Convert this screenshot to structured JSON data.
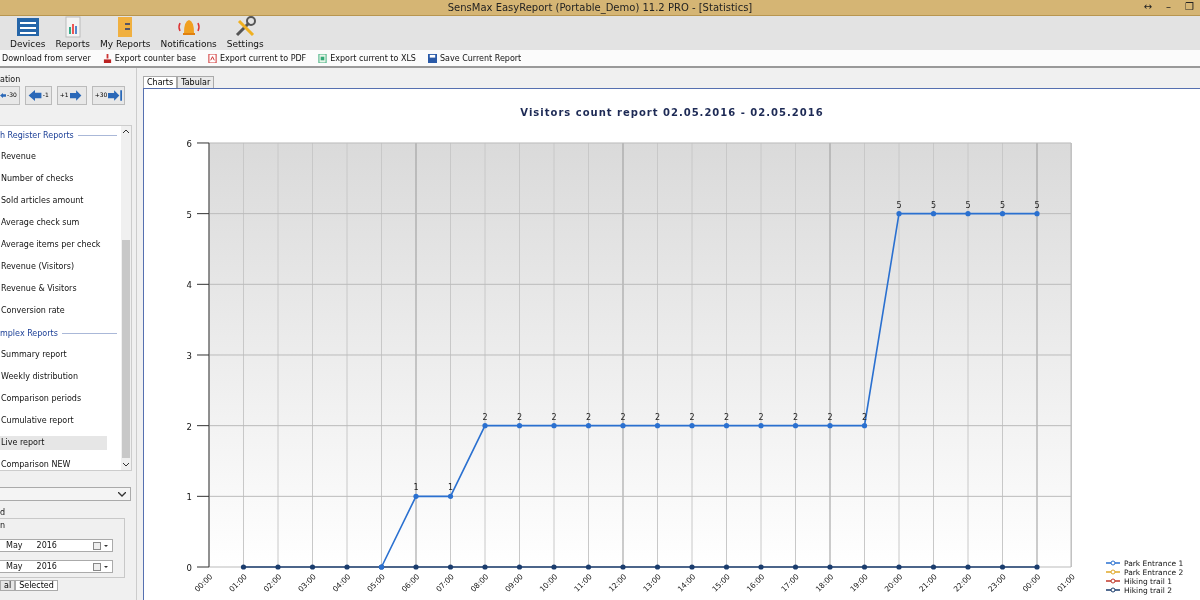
{
  "window": {
    "title": "SensMax EasyReport (Portable_Demo) 11.2 PRO - [Statistics]",
    "controls": [
      "↔",
      "–",
      "❐"
    ]
  },
  "toolbar": [
    {
      "label": "Devices",
      "kind": "devices"
    },
    {
      "label": "Reports",
      "kind": "reports"
    },
    {
      "label": "My Reports",
      "kind": "myreports"
    },
    {
      "label": "Notifications",
      "kind": "bell"
    },
    {
      "label": "Settings",
      "kind": "tools"
    }
  ],
  "commands": [
    {
      "label": "Download from server",
      "kind": "none"
    },
    {
      "label": "Export counter base",
      "kind": "export"
    },
    {
      "label": "Export current to PDF",
      "kind": "pdf"
    },
    {
      "label": "Export current to XLS",
      "kind": "xls"
    },
    {
      "label": "Save Current Report",
      "kind": "save"
    }
  ],
  "navigation": {
    "label": "ation",
    "buttons": [
      {
        "label": "-30",
        "kind": "first"
      },
      {
        "label": "-1",
        "kind": "prev"
      },
      {
        "label": "+1",
        "kind": "next"
      },
      {
        "label": "+30",
        "kind": "last"
      }
    ]
  },
  "report_list": [
    {
      "kind": "header",
      "label": "h Register Reports"
    },
    {
      "kind": "item",
      "label": "Revenue",
      "selected": false
    },
    {
      "kind": "item",
      "label": "Number of checks",
      "selected": false
    },
    {
      "kind": "item",
      "label": "Sold articles amount",
      "selected": false
    },
    {
      "kind": "item",
      "label": "Average check sum",
      "selected": false
    },
    {
      "kind": "item",
      "label": "Average items per check",
      "selected": false
    },
    {
      "kind": "item",
      "label": "Revenue (Visitors)",
      "selected": false
    },
    {
      "kind": "item",
      "label": "Revenue & Visitors",
      "selected": false
    },
    {
      "kind": "item",
      "label": "Conversion rate",
      "selected": false
    },
    {
      "kind": "header",
      "label": "mplex Reports"
    },
    {
      "kind": "item",
      "label": "Summary report",
      "selected": false
    },
    {
      "kind": "item",
      "label": "Weekly distribution",
      "selected": false
    },
    {
      "kind": "item",
      "label": "Comparison periods",
      "selected": false
    },
    {
      "kind": "item",
      "label": "Cumulative report",
      "selected": false
    },
    {
      "kind": "item",
      "label": "Live report",
      "selected": true
    },
    {
      "kind": "item",
      "label": "Comparison NEW",
      "selected": false
    }
  ],
  "period": {
    "group_label": "d",
    "sub_label": "n",
    "dates": [
      {
        "month": "May",
        "year": "2016"
      },
      {
        "month": "May",
        "year": "2016"
      }
    ],
    "tabs": [
      {
        "label": "al",
        "selected": false
      },
      {
        "label": "Selected",
        "selected": true
      }
    ]
  },
  "view_tabs": [
    {
      "label": "Charts",
      "selected": true
    },
    {
      "label": "Tabular",
      "selected": false
    }
  ],
  "chart_data": {
    "type": "line",
    "title": "Visitors count report 02.05.2016 - 02.05.2016",
    "categories": [
      "00:00",
      "01:00",
      "02:00",
      "03:00",
      "04:00",
      "05:00",
      "06:00",
      "07:00",
      "08:00",
      "09:00",
      "10:00",
      "11:00",
      "12:00",
      "13:00",
      "14:00",
      "15:00",
      "16:00",
      "17:00",
      "18:00",
      "19:00",
      "20:00",
      "21:00",
      "22:00",
      "23:00",
      "00:00",
      "01:00"
    ],
    "ylim": [
      0,
      6
    ],
    "yticks": [
      0,
      1,
      2,
      3,
      4,
      5,
      6
    ],
    "grid": true,
    "legend": "bottom-right",
    "series": [
      {
        "name": "Park Entrance 1",
        "color": "#2a70d0",
        "values": [
          null,
          null,
          null,
          null,
          null,
          0,
          1,
          1,
          2,
          2,
          2,
          2,
          2,
          2,
          2,
          2,
          2,
          2,
          2,
          2,
          5,
          5,
          5,
          5,
          5,
          null
        ],
        "value_labels": [
          null,
          null,
          null,
          null,
          null,
          null,
          "1",
          "1",
          "2",
          "2",
          "2",
          "2",
          "2",
          "2",
          "2",
          "2",
          "2",
          "2",
          "2",
          "2",
          "5",
          "5",
          "5",
          "5",
          "5",
          null
        ]
      },
      {
        "name": "Park Entrance 2",
        "color": "#e0a828",
        "values": [
          null,
          null,
          null,
          null,
          null,
          null,
          null,
          null,
          null,
          null,
          null,
          null,
          null,
          null,
          null,
          null,
          null,
          null,
          null,
          null,
          null,
          null,
          null,
          null,
          null,
          null
        ]
      },
      {
        "name": "Hiking trail 1",
        "color": "#c0392b",
        "values": [
          null,
          null,
          null,
          null,
          null,
          null,
          null,
          null,
          null,
          null,
          null,
          null,
          null,
          null,
          null,
          null,
          null,
          null,
          null,
          null,
          null,
          null,
          null,
          null,
          null,
          null
        ]
      },
      {
        "name": "Hiking trail 2",
        "color": "#1b3d6e",
        "values": [
          null,
          0,
          0,
          0,
          0,
          0,
          0,
          0,
          0,
          0,
          0,
          0,
          0,
          0,
          0,
          0,
          0,
          0,
          0,
          0,
          0,
          0,
          0,
          0,
          0,
          null
        ]
      }
    ]
  }
}
